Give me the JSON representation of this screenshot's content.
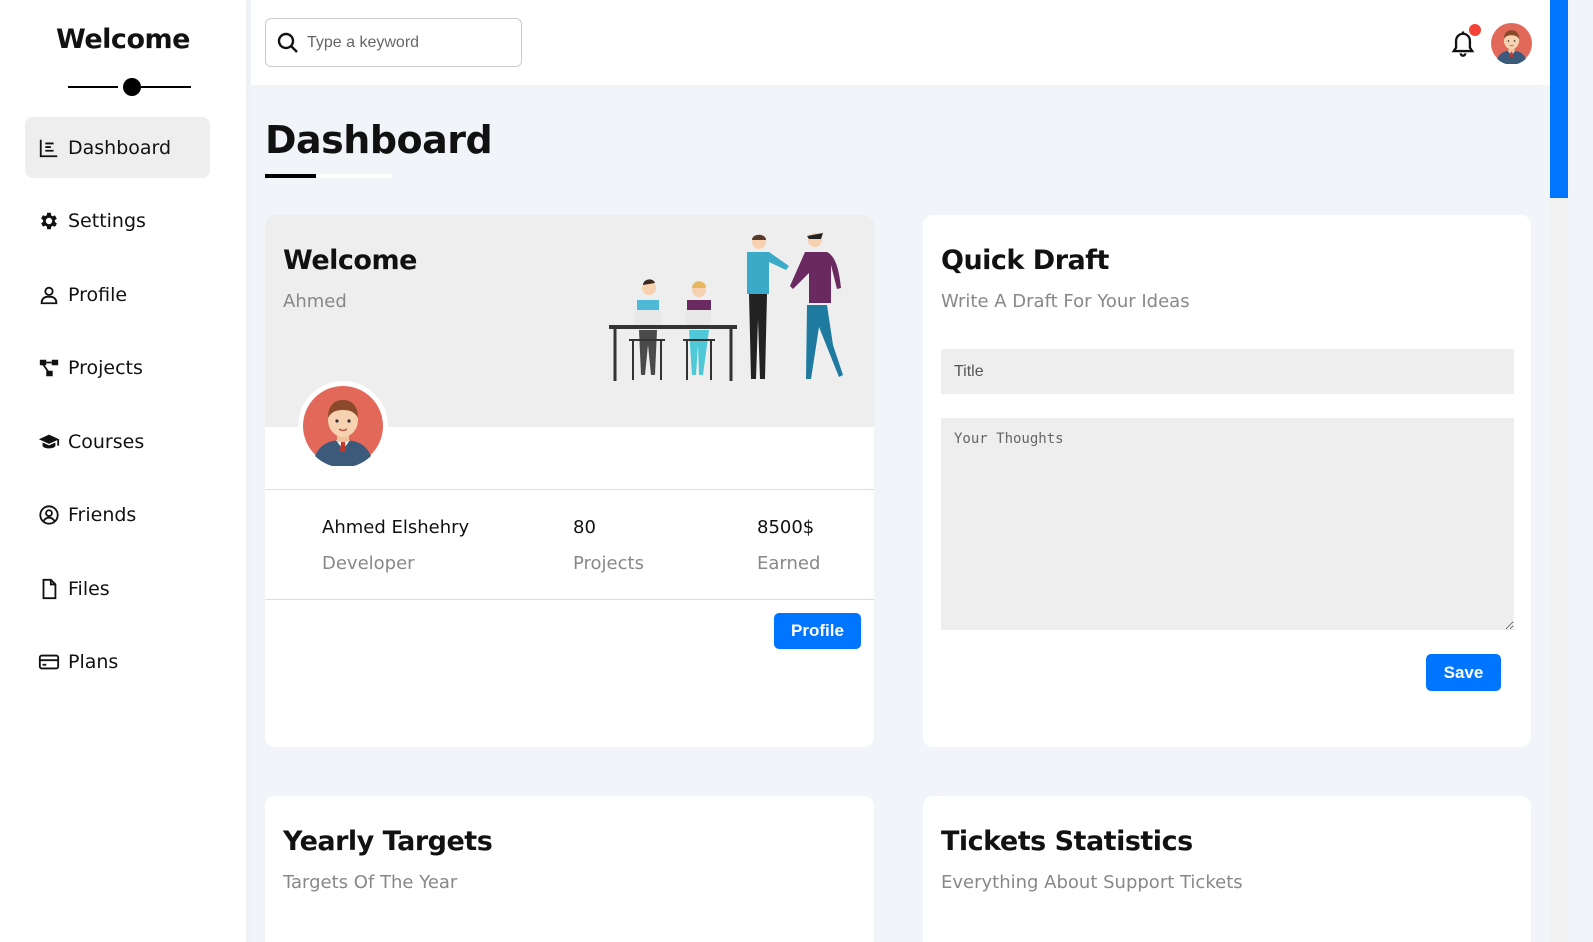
{
  "sidebar": {
    "brand": "Welcome",
    "items": [
      {
        "label": "Dashboard",
        "icon": "chart-icon",
        "active": true
      },
      {
        "label": "Settings",
        "icon": "gear-icon"
      },
      {
        "label": "Profile",
        "icon": "user-icon"
      },
      {
        "label": "Projects",
        "icon": "diagram-icon"
      },
      {
        "label": "Courses",
        "icon": "graduation-cap-icon"
      },
      {
        "label": "Friends",
        "icon": "user-circle-icon"
      },
      {
        "label": "Files",
        "icon": "file-icon"
      },
      {
        "label": "Plans",
        "icon": "credit-card-icon"
      }
    ]
  },
  "header": {
    "search": {
      "placeholder": "Type a keyword",
      "value": ""
    },
    "notification_dot_color": "#f44336"
  },
  "page": {
    "title": "Dashboard"
  },
  "welcome_card": {
    "title": "Welcome",
    "name": "Ahmed",
    "stats": [
      {
        "value": "Ahmed Elshehry",
        "label": "Developer"
      },
      {
        "value": "80",
        "label": "Projects"
      },
      {
        "value": "8500$",
        "label": "Earned"
      }
    ],
    "button": "Profile"
  },
  "quick_draft": {
    "title": "Quick Draft",
    "subtitle": "Write A Draft For Your Ideas",
    "title_placeholder": "Title",
    "body_placeholder": "Your Thoughts",
    "button": "Save"
  },
  "yearly_targets": {
    "title": "Yearly Targets",
    "subtitle": "Targets Of The Year"
  },
  "tickets_statistics": {
    "title": "Tickets Statistics",
    "subtitle": "Everything About Support Tickets"
  },
  "colors": {
    "accent": "#0075ff",
    "page_bg": "#f1f5f9",
    "panel_bg": "#eeeeee",
    "avatar_bg": "#e2685a"
  }
}
